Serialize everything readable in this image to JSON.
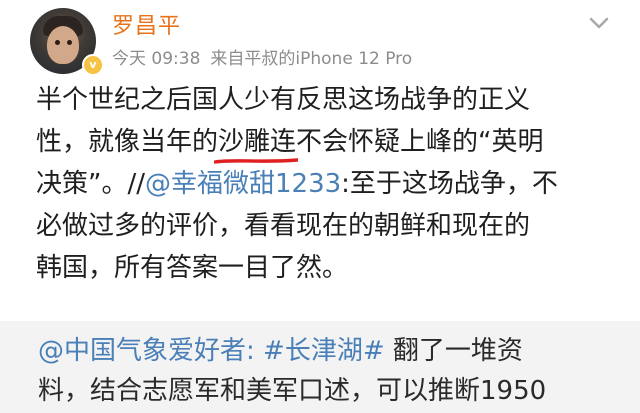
{
  "post": {
    "username": "罗昌平",
    "timestamp": "今天 09:38",
    "source": "来自平叔的iPhone 12 Pro",
    "avatar_icon": "user-avatar-photo",
    "badge_icon": "vip-badge-icon",
    "badge_text": "v",
    "menu_icon": "chevron-down-icon",
    "username_color": "#e8731b",
    "mention_color": "#4a7fb7",
    "underline_color": "#e02020",
    "body": {
      "line1": "半个世纪之后国人少有反思这场战争的正义",
      "line2_before": "性，就像当年的",
      "line2_underlined": "沙雕连",
      "line2_after": "不会怀疑上峰的“英明",
      "line3_before": "决策”。//",
      "line3_mention": "@幸福微甜1233",
      "line3_after": ":至于这场战争，不",
      "line4": "必做过多的评价，看看现在的朝鲜和现在的",
      "line5": "韩国，所有答案一目了然。"
    }
  },
  "repost": {
    "mention": "@中国气象爱好者",
    "separator": ": ",
    "hashtag": "#长津湖#",
    "line1_after": " 翻了一堆资",
    "line2": "料，结合志愿军和美军口述，可以推断1950"
  }
}
